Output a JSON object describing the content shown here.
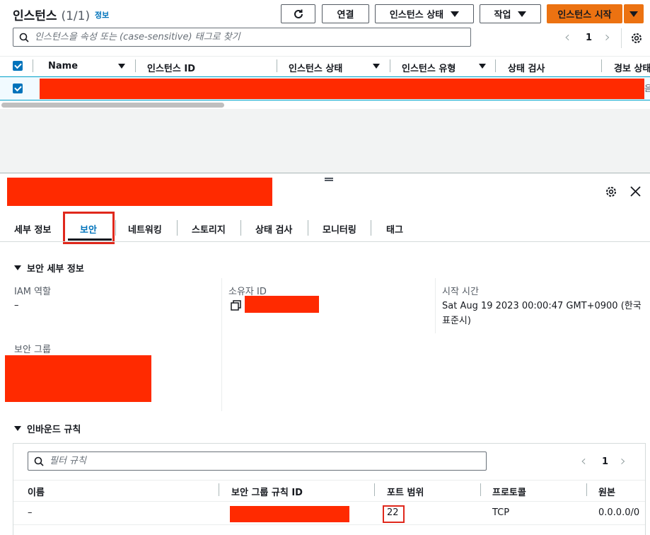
{
  "header": {
    "title": "인스턴스",
    "count": "(1/1)",
    "info_link": "정보",
    "connect": "연결",
    "instance_state": "인스턴스 상태",
    "actions": "작업",
    "launch": "인스턴스 시작"
  },
  "search": {
    "placeholder": "인스턴스을 속성 또는 (case-sensitive) 태그로 찾기"
  },
  "pagination": {
    "page": "1"
  },
  "table": {
    "columns": [
      "Name",
      "인스턴스 ID",
      "인스턴스 상태",
      "인스턴스 유형",
      "상태 검사",
      "경보 상태"
    ],
    "row_overflow_char": "음"
  },
  "detail": {
    "tabs": [
      "세부 정보",
      "보안",
      "네트워킹",
      "스토리지",
      "상태 검사",
      "모니터링",
      "태그"
    ],
    "security_section_title": "보안 세부 정보",
    "iam_role_label": "IAM 역할",
    "iam_role_value": "–",
    "owner_id_label": "소유자 ID",
    "launch_time_label": "시작 시간",
    "launch_time_value": "Sat Aug 19 2023 00:00:47 GMT+0900 (한국 표준시)",
    "security_group_label": "보안 그룹",
    "inbound_title": "인바운드 규칙",
    "filter_placeholder": "필터 규칙",
    "page": "1",
    "rule_columns": [
      "이름",
      "보안 그룹 규칙 ID",
      "포트 범위",
      "프로토콜",
      "원본"
    ],
    "rule_row": {
      "name": "–",
      "port": "22",
      "protocol": "TCP",
      "source": "0.0.0.0/0"
    }
  },
  "colors": {
    "accent": "#ec7211",
    "selected_tab": "#0073bb",
    "redaction": "#ff2a00",
    "highlight_box": "#e0281c"
  }
}
